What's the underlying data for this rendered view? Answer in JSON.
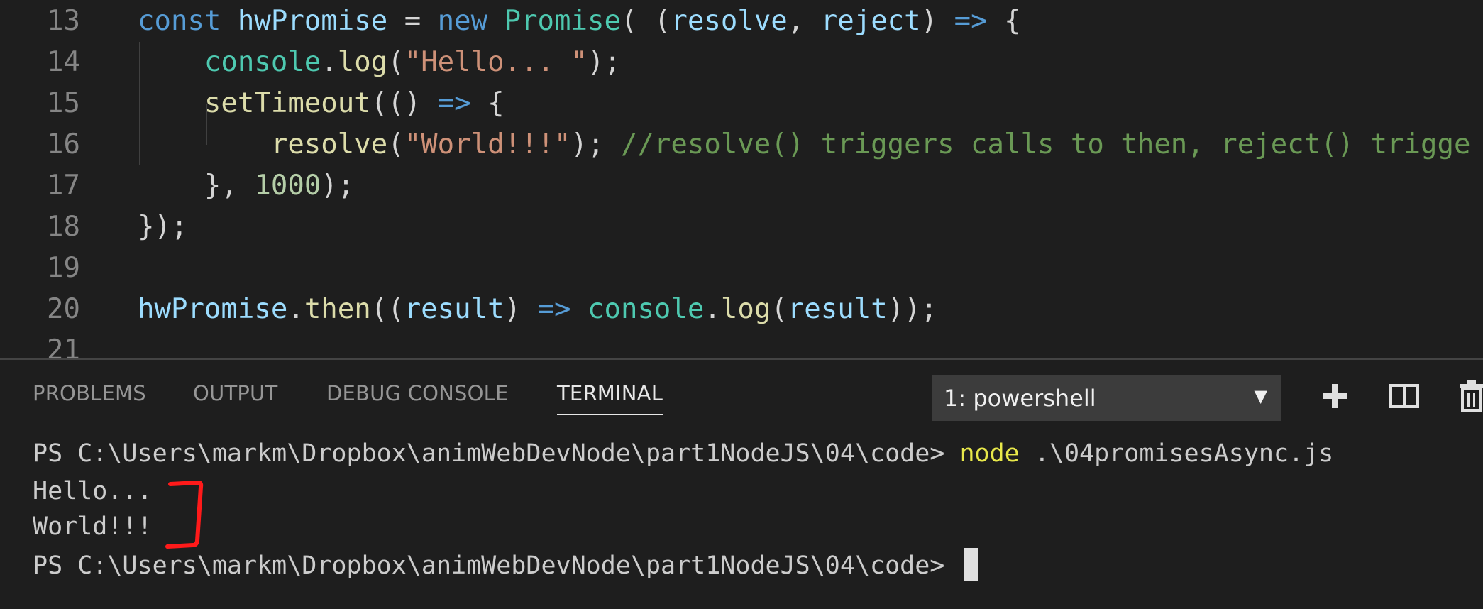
{
  "editor": {
    "lines": [
      {
        "num": "13",
        "tokens": [
          {
            "t": "const ",
            "c": "kw"
          },
          {
            "t": "hwPromise",
            "c": "var"
          },
          {
            "t": " = ",
            "c": "pun"
          },
          {
            "t": "new ",
            "c": "kw"
          },
          {
            "t": "Promise",
            "c": "type"
          },
          {
            "t": "( (",
            "c": "pun"
          },
          {
            "t": "resolve",
            "c": "var"
          },
          {
            "t": ", ",
            "c": "pun"
          },
          {
            "t": "reject",
            "c": "var"
          },
          {
            "t": ") ",
            "c": "pun"
          },
          {
            "t": "=>",
            "c": "kw"
          },
          {
            "t": " {",
            "c": "pun"
          }
        ]
      },
      {
        "num": "14",
        "tokens": [
          {
            "t": "    ",
            "c": "pun"
          },
          {
            "t": "console",
            "c": "type"
          },
          {
            "t": ".",
            "c": "pun"
          },
          {
            "t": "log",
            "c": "fn"
          },
          {
            "t": "(",
            "c": "pun"
          },
          {
            "t": "\"Hello... \"",
            "c": "str"
          },
          {
            "t": ");",
            "c": "pun"
          }
        ]
      },
      {
        "num": "15",
        "tokens": [
          {
            "t": "    ",
            "c": "pun"
          },
          {
            "t": "setTimeout",
            "c": "fn"
          },
          {
            "t": "(() ",
            "c": "pun"
          },
          {
            "t": "=>",
            "c": "kw"
          },
          {
            "t": " {",
            "c": "pun"
          }
        ]
      },
      {
        "num": "16",
        "tokens": [
          {
            "t": "        ",
            "c": "pun"
          },
          {
            "t": "resolve",
            "c": "fn"
          },
          {
            "t": "(",
            "c": "pun"
          },
          {
            "t": "\"World!!!\"",
            "c": "str"
          },
          {
            "t": "); ",
            "c": "pun"
          },
          {
            "t": "//resolve() triggers calls to then, reject() trigge",
            "c": "cmt"
          }
        ]
      },
      {
        "num": "17",
        "tokens": [
          {
            "t": "    }, ",
            "c": "pun"
          },
          {
            "t": "1000",
            "c": "num"
          },
          {
            "t": ");",
            "c": "pun"
          }
        ]
      },
      {
        "num": "18",
        "tokens": [
          {
            "t": "});",
            "c": "pun"
          }
        ]
      },
      {
        "num": "19",
        "tokens": []
      },
      {
        "num": "20",
        "tokens": [
          {
            "t": "hwPromise",
            "c": "var"
          },
          {
            "t": ".",
            "c": "pun"
          },
          {
            "t": "then",
            "c": "fn"
          },
          {
            "t": "((",
            "c": "pun"
          },
          {
            "t": "result",
            "c": "var"
          },
          {
            "t": ") ",
            "c": "pun"
          },
          {
            "t": "=>",
            "c": "kw"
          },
          {
            "t": " ",
            "c": "pun"
          },
          {
            "t": "console",
            "c": "type"
          },
          {
            "t": ".",
            "c": "pun"
          },
          {
            "t": "log",
            "c": "fn"
          },
          {
            "t": "(",
            "c": "pun"
          },
          {
            "t": "result",
            "c": "var"
          },
          {
            "t": "));",
            "c": "pun"
          }
        ]
      },
      {
        "num": "21",
        "tokens": []
      }
    ]
  },
  "panel": {
    "tabs": [
      "PROBLEMS",
      "OUTPUT",
      "DEBUG CONSOLE",
      "TERMINAL"
    ],
    "active_tab": "TERMINAL",
    "terminal_select": "1: powershell",
    "icons": [
      "plus-icon",
      "split-icon",
      "trash-icon"
    ]
  },
  "terminal": {
    "prompt": "PS C:\\Users\\markm\\Dropbox\\animWebDevNode\\part1NodeJS\\04\\code> ",
    "command": "node",
    "args": " .\\04promisesAsync.js",
    "output1": "Hello...",
    "output2": "World!!!",
    "prompt2": "PS C:\\Users\\markm\\Dropbox\\animWebDevNode\\part1NodeJS\\04\\code> "
  },
  "colors": {
    "background": "#1e1e1e",
    "annotation": "#ff1a1a",
    "command": "#e8e84a"
  }
}
